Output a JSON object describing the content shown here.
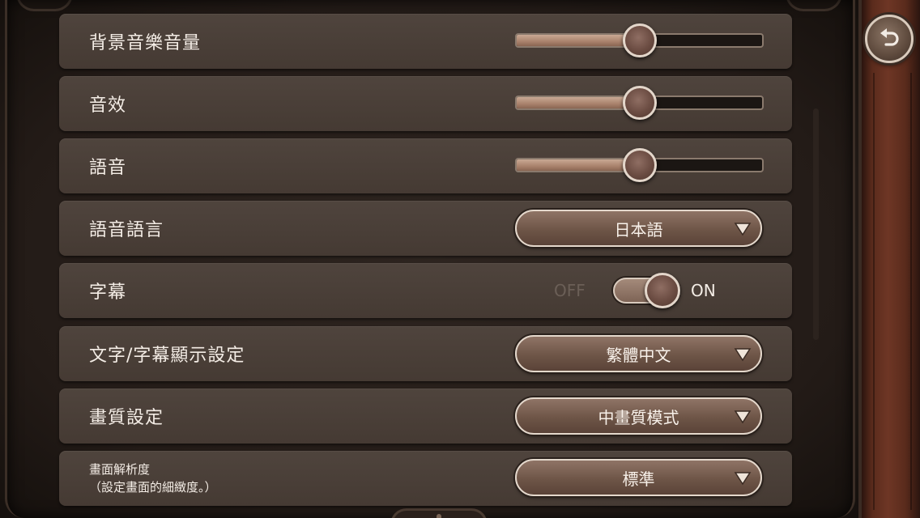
{
  "settings": {
    "bgm_volume": {
      "label": "背景音樂音量",
      "level": 0.5
    },
    "sfx_volume": {
      "label": "音效",
      "level": 0.5
    },
    "voice_volume": {
      "label": "語音",
      "level": 0.5
    },
    "voice_language": {
      "label": "語音語言",
      "value": "日本語"
    },
    "subtitles": {
      "label": "字幕",
      "off_label": "OFF",
      "on_label": "ON",
      "state": "on"
    },
    "text_display": {
      "label": "文字/字幕顯示設定",
      "value": "繁體中文"
    },
    "graphics_quality": {
      "label": "畫質設定",
      "value": "中畫質模式"
    },
    "resolution": {
      "label_line1": "畫面解析度",
      "label_line2": "（設定畫面的細緻度。）",
      "value": "標準"
    }
  },
  "icons": {
    "back": "back-arrow-icon",
    "dropdown": "triangle-down-icon"
  }
}
